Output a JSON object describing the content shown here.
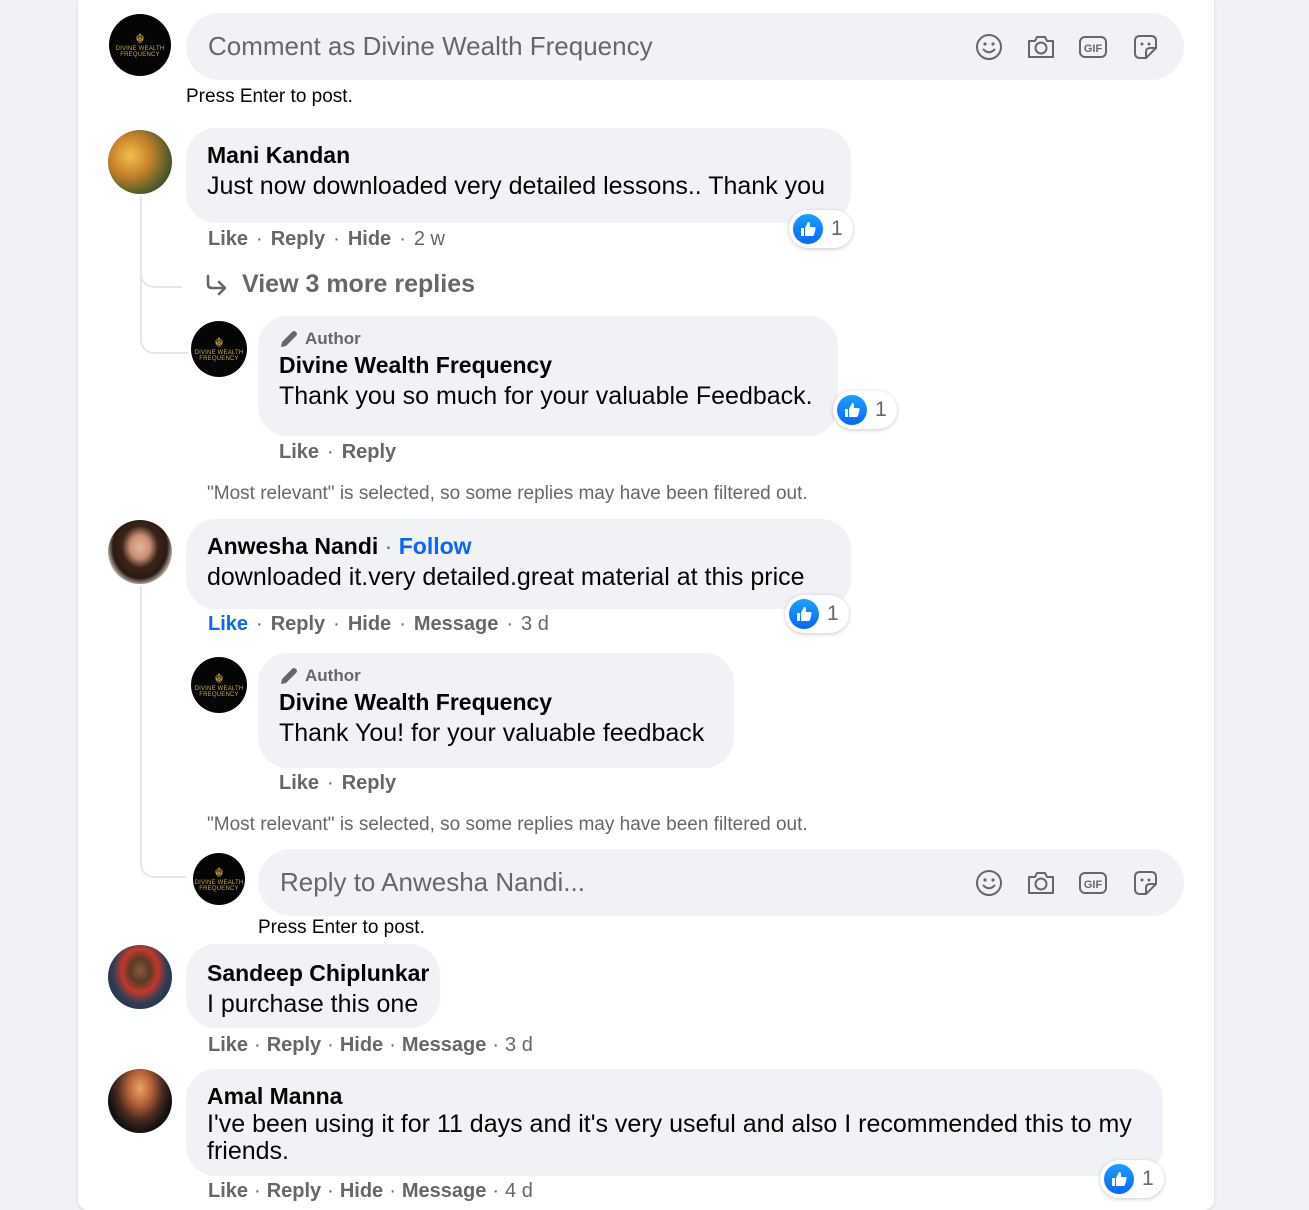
{
  "page": {
    "name": "Divine Wealth Frequency",
    "logo_text": "DIVINE WEALTH FREQUENCY"
  },
  "composer": {
    "placeholder": "Comment as Divine Wealth Frequency",
    "hint": "Press Enter to post.",
    "icons": [
      "emoji-icon",
      "camera-icon",
      "gif-icon",
      "sticker-icon"
    ]
  },
  "comments": [
    {
      "author": "Mani Kandan",
      "text": "Just now downloaded very detailed lessons.. Thank you",
      "actions": [
        "Like",
        "Reply",
        "Hide"
      ],
      "time": "2 w",
      "reactions": "1",
      "view_more": "View 3 more replies",
      "reply": {
        "badge": "Author",
        "author": "Divine Wealth Frequency",
        "text": "Thank you so much for your valuable Feedback.",
        "actions": [
          "Like",
          "Reply"
        ],
        "reactions": "1"
      },
      "filtered_note": "\"Most relevant\" is selected, so some replies may have been filtered out."
    },
    {
      "author": "Anwesha Nandi",
      "follow": "Follow",
      "text": "downloaded it.very detailed.great material at this price",
      "actions": [
        "Like",
        "Reply",
        "Hide",
        "Message"
      ],
      "liked": true,
      "time": "3 d",
      "reactions": "1",
      "reply": {
        "badge": "Author",
        "author": "Divine Wealth Frequency",
        "text": "Thank You! for your valuable feedback",
        "actions": [
          "Like",
          "Reply"
        ]
      },
      "filtered_note": "\"Most relevant\" is selected, so some replies may have been filtered out.",
      "reply_composer": {
        "placeholder": "Reply to Anwesha Nandi...",
        "hint": "Press Enter to post."
      }
    },
    {
      "author": "Sandeep Chiplunkar",
      "text": "I purchase this one",
      "actions": [
        "Like",
        "Reply",
        "Hide",
        "Message"
      ],
      "time": "3 d"
    },
    {
      "author": "Amal Manna",
      "text": "I've been using it for 11 days and it's very useful and also I recommended this to my friends.",
      "actions": [
        "Like",
        "Reply",
        "Hide",
        "Message"
      ],
      "time": "4 d",
      "reactions": "1"
    }
  ],
  "colors": {
    "link": "#0866ff",
    "muted": "#65676b",
    "bubble": "#f0f2f5"
  }
}
